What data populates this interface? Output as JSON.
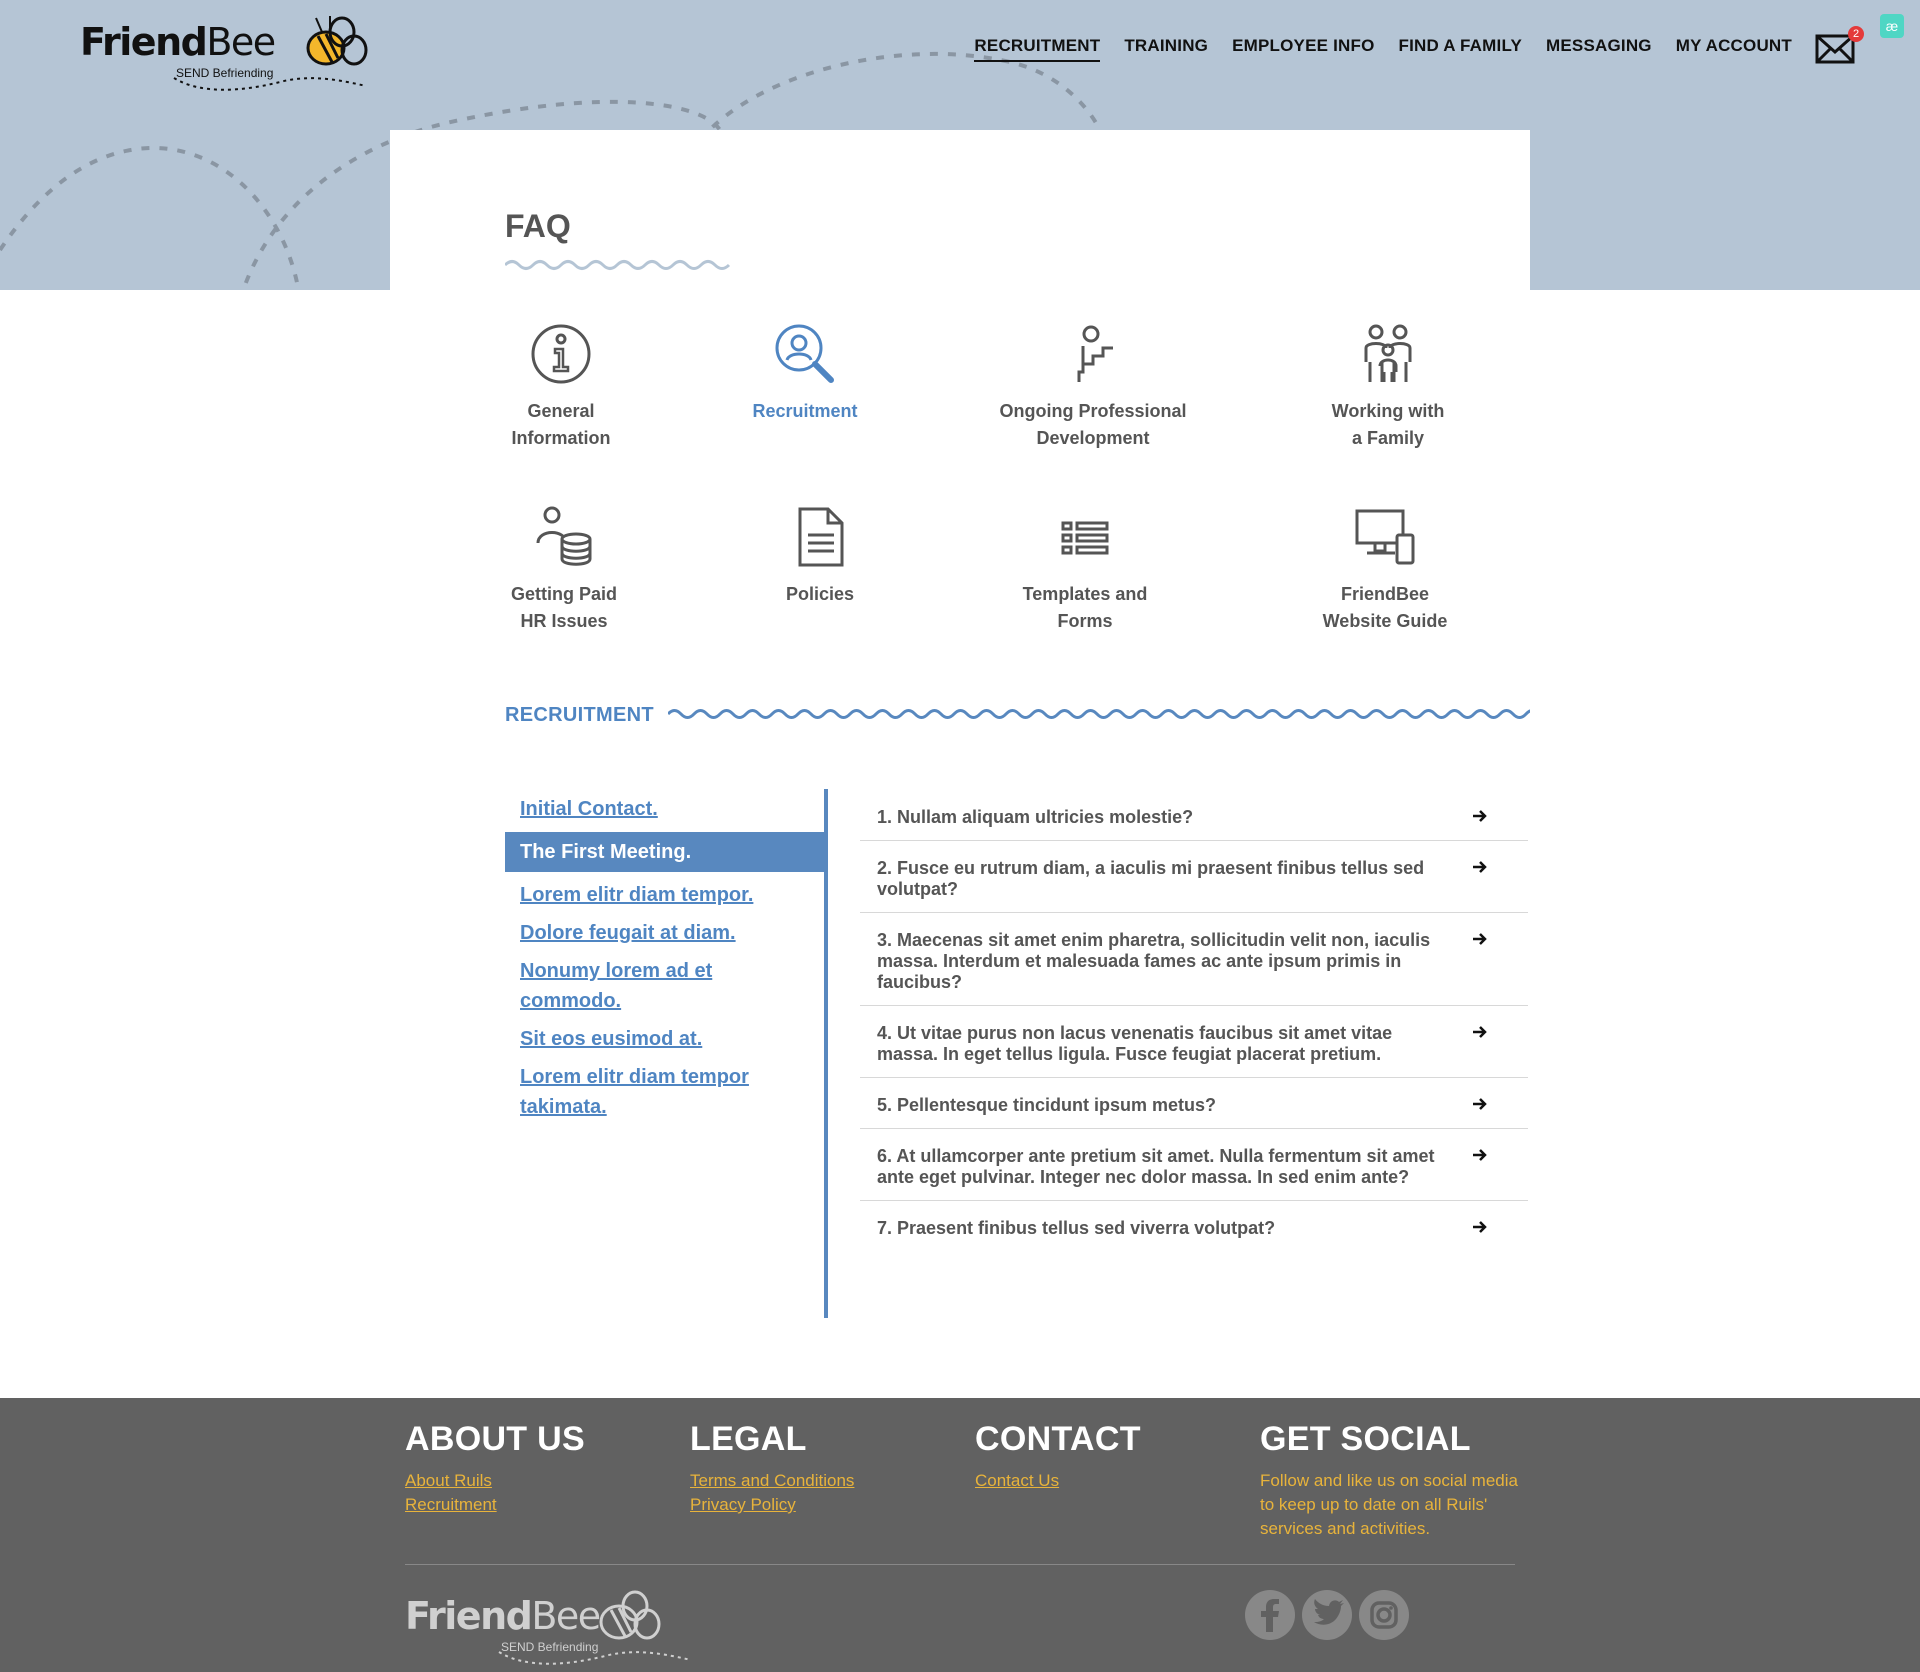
{
  "brand": {
    "name_bold": "Friend",
    "name_light": "Bee",
    "tagline": "SEND Befriending"
  },
  "nav": {
    "items": [
      {
        "label": "RECRUITMENT",
        "active": true
      },
      {
        "label": "TRAINING"
      },
      {
        "label": "EMPLOYEE INFO"
      },
      {
        "label": "FIND A FAMILY"
      },
      {
        "label": "MESSAGING"
      },
      {
        "label": "MY ACCOUNT"
      }
    ],
    "mail_count": "2",
    "ae_badge": "æ"
  },
  "page": {
    "title": "FAQ"
  },
  "categories": [
    {
      "icon": "info-icon",
      "line1": "General",
      "line2": "Information"
    },
    {
      "icon": "search-user-icon",
      "line1": "Recruitment",
      "line2": "",
      "active": true
    },
    {
      "icon": "career-steps-icon",
      "line1": "Ongoing Professional",
      "line2": "Development"
    },
    {
      "icon": "family-icon",
      "line1": "Working with",
      "line2": "a Family"
    },
    {
      "icon": "person-coins-icon",
      "line1": "Getting Paid",
      "line2": "HR Issues"
    },
    {
      "icon": "document-icon",
      "line1": "Policies",
      "line2": ""
    },
    {
      "icon": "list-icon",
      "line1": "Templates and",
      "line2": "Forms"
    },
    {
      "icon": "devices-icon",
      "line1": "FriendBee",
      "line2": "Website Guide"
    }
  ],
  "section": {
    "title": "RECRUITMENT"
  },
  "topics": [
    {
      "label": "Initial Contact."
    },
    {
      "label": "The First Meeting.",
      "active": true
    },
    {
      "label": "Lorem elitr diam tempor."
    },
    {
      "label": "Dolore feugait at diam."
    },
    {
      "label": "Nonumy lorem ad et commodo."
    },
    {
      "label": "Sit eos eusimod at."
    },
    {
      "label": "Lorem elitr diam tempor takimata."
    }
  ],
  "questions": [
    {
      "text": "1. Nullam aliquam ultricies molestie?"
    },
    {
      "text": "2. Fusce eu rutrum diam, a iaculis mi praesent finibus tellus sed volutpat?"
    },
    {
      "text": "3. Maecenas sit amet enim pharetra, sollicitudin velit non, iaculis massa. Interdum et malesuada fames ac ante ipsum primis in faucibus?"
    },
    {
      "text": "4. Ut vitae purus non lacus venenatis faucibus sit amet vitae massa. In eget tellus ligula. Fusce feugiat placerat pretium."
    },
    {
      "text": "5. Pellentesque tincidunt ipsum metus?"
    },
    {
      "text": "6. At ullamcorper ante pretium sit amet. Nulla fermentum sit amet ante eget pulvinar. Integer nec dolor massa. In sed enim ante?"
    },
    {
      "text": "7. Praesent finibus tellus sed viverra volutpat?"
    }
  ],
  "footer": {
    "about": {
      "title": "ABOUT US",
      "links": [
        "About Ruils",
        "Recruitment"
      ]
    },
    "legal": {
      "title": "LEGAL",
      "links": [
        "Terms and Conditions",
        "Privacy Policy"
      ]
    },
    "contact": {
      "title": "CONTACT",
      "links": [
        "Contact Us"
      ]
    },
    "social": {
      "title": "GET SOCIAL",
      "text": "Follow and like us on social media to keep up to date on all Ruils' services and activities."
    },
    "social_icons": [
      "facebook-icon",
      "twitter-icon",
      "instagram-icon"
    ]
  },
  "colors": {
    "accent": "#4f85c2",
    "hero": "#b5c5d5",
    "footer": "#616161",
    "footer_link": "#e8b33b"
  }
}
